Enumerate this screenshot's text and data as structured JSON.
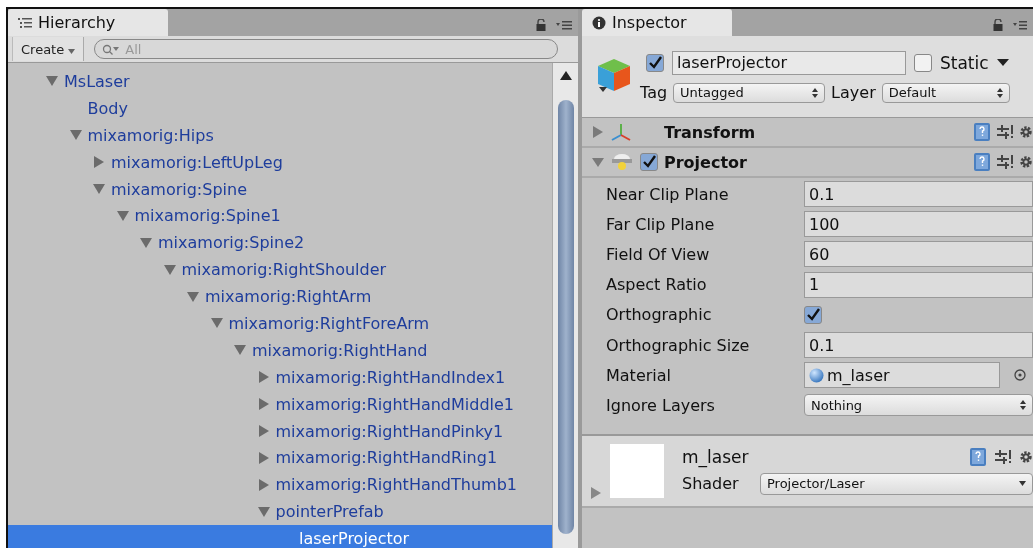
{
  "hierarchy": {
    "tab": "Hierarchy",
    "create_button": "Create",
    "search": {
      "placeholder": "All"
    },
    "tree": [
      {
        "name": "MsLaser",
        "expanded": true,
        "selected": false,
        "children": [
          {
            "name": "Body",
            "selected": false
          },
          {
            "name": "mixamorig:Hips",
            "expanded": true,
            "selected": false,
            "children": [
              {
                "name": "mixamorig:LeftUpLeg",
                "expanded": false,
                "selected": false
              },
              {
                "name": "mixamorig:Spine",
                "expanded": true,
                "selected": false,
                "children": [
                  {
                    "name": "mixamorig:Spine1",
                    "expanded": true,
                    "selected": false,
                    "children": [
                      {
                        "name": "mixamorig:Spine2",
                        "expanded": true,
                        "selected": false,
                        "children": [
                          {
                            "name": "mixamorig:RightShoulder",
                            "expanded": true,
                            "selected": false,
                            "children": [
                              {
                                "name": "mixamorig:RightArm",
                                "expanded": true,
                                "selected": false,
                                "children": [
                                  {
                                    "name": "mixamorig:RightForeArm",
                                    "expanded": true,
                                    "selected": false,
                                    "children": [
                                      {
                                        "name": "mixamorig:RightHand",
                                        "expanded": true,
                                        "selected": false,
                                        "children": [
                                          {
                                            "name": "mixamorig:RightHandIndex1",
                                            "expanded": false,
                                            "selected": false
                                          },
                                          {
                                            "name": "mixamorig:RightHandMiddle1",
                                            "expanded": false,
                                            "selected": false
                                          },
                                          {
                                            "name": "mixamorig:RightHandPinky1",
                                            "expanded": false,
                                            "selected": false
                                          },
                                          {
                                            "name": "mixamorig:RightHandRing1",
                                            "expanded": false,
                                            "selected": false
                                          },
                                          {
                                            "name": "mixamorig:RightHandThumb1",
                                            "expanded": false,
                                            "selected": false
                                          },
                                          {
                                            "name": "pointerPrefab",
                                            "expanded": true,
                                            "selected": false,
                                            "children": [
                                              {
                                                "name": "laserProjector",
                                                "selected": true
                                              }
                                            ]
                                          }
                                        ]
                                      }
                                    ]
                                  }
                                ]
                              }
                            ]
                          }
                        ]
                      }
                    ]
                  }
                ]
              }
            ]
          }
        ]
      }
    ]
  },
  "inspector": {
    "tab": "Inspector",
    "object": {
      "active": true,
      "name": "laserProjector",
      "static": false,
      "static_label": "Static",
      "tag_label": "Tag",
      "tag": "Untagged",
      "layer_label": "Layer",
      "layer": "Default"
    },
    "components": [
      {
        "kind": "transform",
        "name": "Transform",
        "expanded": false
      },
      {
        "kind": "projector",
        "name": "Projector",
        "expanded": true,
        "enabled": true
      }
    ],
    "properties": [
      {
        "kind": "number",
        "label": "Near Clip Plane",
        "value": "0.1"
      },
      {
        "kind": "number",
        "label": "Far Clip Plane",
        "value": "100"
      },
      {
        "kind": "number",
        "label": "Field Of View",
        "value": "60"
      },
      {
        "kind": "number",
        "label": "Aspect Ratio",
        "value": "1"
      },
      {
        "kind": "checkbox",
        "label": "Orthographic",
        "checked": true
      },
      {
        "kind": "number",
        "label": "Orthographic Size",
        "value": "0.1"
      },
      {
        "kind": "object",
        "label": "Material",
        "value": "m_laser"
      },
      {
        "kind": "dropdown",
        "label": "Ignore Layers",
        "value": "Nothing"
      }
    ],
    "material": {
      "name": "m_laser",
      "shader_label": "Shader",
      "shader": "Projector/Laser",
      "expanded": false
    }
  }
}
